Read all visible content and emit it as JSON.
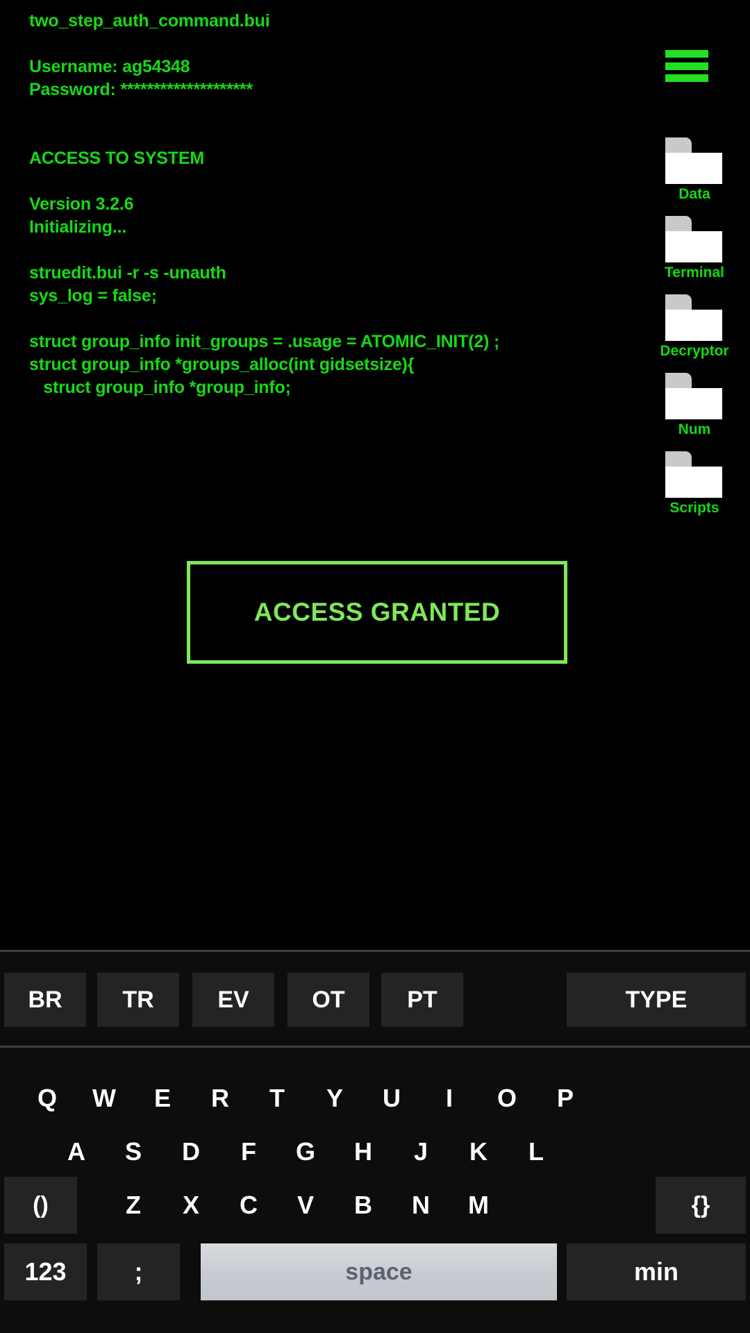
{
  "terminal": {
    "lines": [
      "two_step_auth_command.bui",
      "",
      "Username: ag54348",
      "Password: ********************",
      "",
      "ACCESS TO SYSTEM",
      "",
      "Version 3.2.6",
      "Initializing...",
      "",
      "struedit.bui -r -s -unauth",
      "sys_log = false;",
      "",
      "struct group_info init_groups = .usage = ATOMIC_INIT(2) ;",
      "struct group_info *groups_alloc(int gidsetsize){",
      "   struct group_info *group_info;"
    ]
  },
  "menu": {
    "icon": "hamburger-menu-icon"
  },
  "sidebar": {
    "folders": [
      {
        "label": "Data"
      },
      {
        "label": "Terminal"
      },
      {
        "label": "Decryptor"
      },
      {
        "label": "Num"
      },
      {
        "label": "Scripts"
      }
    ]
  },
  "status_box": {
    "text": "ACCESS GRANTED",
    "border_color": "#7ee85a",
    "text_color": "#7ee85a"
  },
  "colors": {
    "terminal_green": "#16d916",
    "background": "#000000",
    "keyboard_background": "#0d0d0d",
    "key_fill": "#242424",
    "space_key": "#c8ccd2"
  },
  "keyboard": {
    "suggestions": [
      "BR",
      "TR",
      "EV",
      "OT",
      "PT"
    ],
    "type_label": "TYPE",
    "row1": [
      "Q",
      "W",
      "E",
      "R",
      "T",
      "Y",
      "U",
      "I",
      "O",
      "P"
    ],
    "row2": [
      "A",
      "S",
      "D",
      "F",
      "G",
      "H",
      "J",
      "K",
      "L"
    ],
    "row3_left": "()",
    "row3": [
      "Z",
      "X",
      "C",
      "V",
      "B",
      "N",
      "M"
    ],
    "row3_right": "{}",
    "row4": {
      "numbers": "123",
      "semicolon": ";",
      "space": "space",
      "min": "min"
    }
  }
}
